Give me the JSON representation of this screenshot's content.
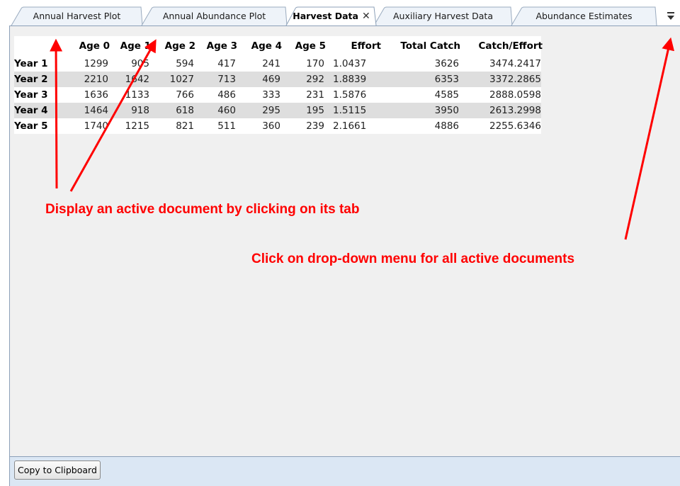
{
  "tabs": [
    {
      "label": "Annual Harvest Plot",
      "active": false
    },
    {
      "label": "Annual Abundance Plot",
      "active": false
    },
    {
      "label": "Harvest Data",
      "active": true,
      "close_icon": "close-icon",
      "close_glyph": "✕"
    },
    {
      "label": "Auxiliary Harvest Data",
      "active": false
    },
    {
      "label": "Abundance Estimates",
      "active": false
    }
  ],
  "tab_overflow_icon": "dropdown-overflow-icon",
  "table": {
    "columns": [
      "",
      "Age 0",
      "Age 1",
      "Age 2",
      "Age 3",
      "Age 4",
      "Age 5",
      "Effort",
      "Total Catch",
      "Catch/Effort"
    ],
    "rows": [
      [
        "Year 1",
        "1299",
        "905",
        "594",
        "417",
        "241",
        "170",
        "1.0437",
        "3626",
        "3474.2417"
      ],
      [
        "Year 2",
        "2210",
        "1642",
        "1027",
        "713",
        "469",
        "292",
        "1.8839",
        "6353",
        "3372.2865"
      ],
      [
        "Year 3",
        "1636",
        "1133",
        "766",
        "486",
        "333",
        "231",
        "1.5876",
        "4585",
        "2888.0598"
      ],
      [
        "Year 4",
        "1464",
        "918",
        "618",
        "460",
        "295",
        "195",
        "1.5115",
        "3950",
        "2613.2998"
      ],
      [
        "Year 5",
        "1740",
        "1215",
        "821",
        "511",
        "360",
        "239",
        "2.1661",
        "4886",
        "2255.6346"
      ]
    ]
  },
  "footer": {
    "copy_button": "Copy to Clipboard"
  },
  "annotations": {
    "tab_hint": "Display an active document by clicking on its tab",
    "menu_hint": "Click on drop-down menu for all active documents"
  },
  "colors": {
    "annotation": "#ff0000",
    "frame_border": "#8ca0b8",
    "footer_bg": "#dbe7f4",
    "alt_row": "#dedede"
  }
}
